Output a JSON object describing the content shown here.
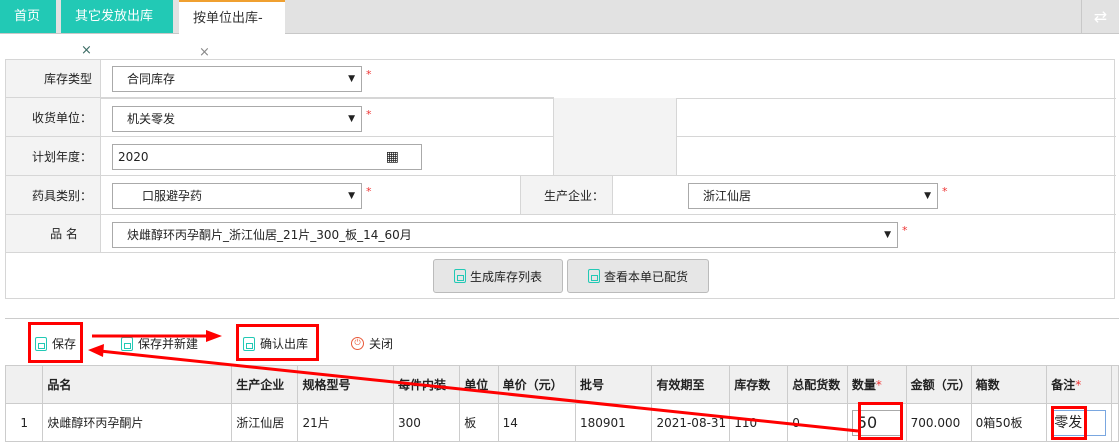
{
  "tabs": [
    {
      "label": "首页"
    },
    {
      "label": "其它发放出库",
      "close": "×"
    },
    {
      "label": "按单位出库-",
      "close": "×"
    }
  ],
  "form": {
    "stock_type": {
      "label": "库存类型",
      "value": "合同库存"
    },
    "receiver": {
      "label": "收货单位：",
      "value": "机关零发"
    },
    "plan_year": {
      "label": "计划年度：",
      "value": "2020"
    },
    "drug_category": {
      "label": "药具类别：",
      "value": "口服避孕药"
    },
    "manufacturer": {
      "label": "生产企业：",
      "value": "浙江仙居"
    },
    "product": {
      "label": "品 名",
      "value": "炔雌醇环丙孕酮片_浙江仙居_21片_300_板_14_60月"
    },
    "required_mark": "*",
    "generate_button": "生成库存列表",
    "view_button": "查看本单已配货"
  },
  "toolbar": {
    "save": "保存",
    "save_new": "保存并新建",
    "confirm": "确认出库",
    "close": "关闭"
  },
  "table": {
    "headers": [
      "",
      "品名",
      "生产企业",
      "规格型号",
      "每件内装",
      "单位",
      "单价（元）",
      "批号",
      "有效期至",
      "库存数",
      "总配货数",
      "数量",
      "金额（元）",
      "箱数",
      "备注"
    ],
    "rows": [
      [
        "1",
        "炔雌醇环丙孕酮片",
        "浙江仙居",
        "21片",
        "300",
        "板",
        "14",
        "180901",
        "2021-08-31",
        "110",
        "0",
        "50",
        "700.000",
        "0箱50板",
        "零发"
      ]
    ]
  },
  "annotation_color": "#ff0000",
  "accent_color": "#22c9b5"
}
